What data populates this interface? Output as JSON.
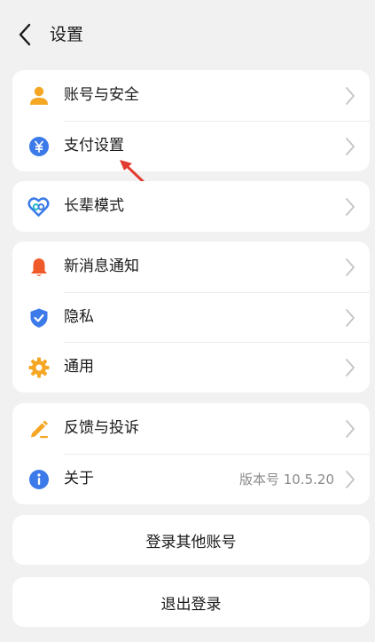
{
  "header": {
    "title": "设置"
  },
  "groups": {
    "g1": [
      {
        "label": "账号与安全",
        "icon": "user-icon",
        "color": "#f5a623"
      },
      {
        "label": "支付设置",
        "icon": "yuan-icon",
        "color": "#3b7ae8"
      }
    ],
    "g2": [
      {
        "label": "长辈模式",
        "icon": "heart-link-icon",
        "color": "#3b7ae8"
      }
    ],
    "g3": [
      {
        "label": "新消息通知",
        "icon": "bell-icon",
        "color": "#f05a2b"
      },
      {
        "label": "隐私",
        "icon": "shield-icon",
        "color": "#3b7ae8"
      },
      {
        "label": "通用",
        "icon": "gear-icon",
        "color": "#f5a623"
      }
    ],
    "g4": [
      {
        "label": "反馈与投诉",
        "icon": "pen-icon",
        "color": "#f5a623"
      },
      {
        "label": "关于",
        "icon": "info-icon",
        "color": "#3b7ae8",
        "value": "版本号 10.5.20"
      }
    ]
  },
  "buttons": {
    "switch_account": "登录其他账号",
    "logout": "退出登录"
  },
  "colors": {
    "accent_blue": "#3b7ae8",
    "accent_orange": "#f5a623",
    "annotation_red": "#e23b30"
  }
}
